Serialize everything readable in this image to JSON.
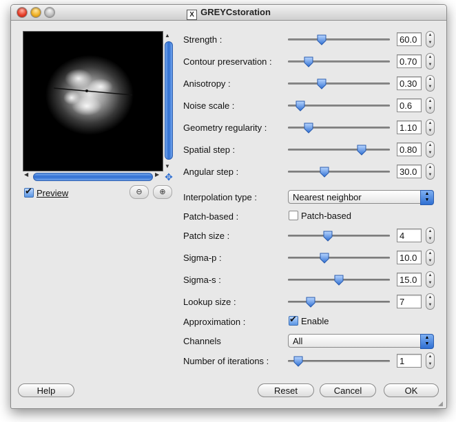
{
  "window": {
    "title": "GREYCstoration"
  },
  "preview": {
    "checkbox_label": "Preview",
    "checked": true
  },
  "params": {
    "strength": {
      "label": "Strength :",
      "value": "60.0",
      "slider_fraction": 0.33
    },
    "contour": {
      "label": "Contour preservation :",
      "value": "0.70",
      "slider_fraction": 0.2
    },
    "anisotropy": {
      "label": "Anisotropy :",
      "value": "0.30",
      "slider_fraction": 0.33
    },
    "noise_scale": {
      "label": "Noise scale :",
      "value": "0.6",
      "slider_fraction": 0.12
    },
    "geometry": {
      "label": "Geometry regularity :",
      "value": "1.10",
      "slider_fraction": 0.2
    },
    "spatial_step": {
      "label": "Spatial step :",
      "value": "0.80",
      "slider_fraction": 0.72
    },
    "angular_step": {
      "label": "Angular step :",
      "value": "30.0",
      "slider_fraction": 0.36
    },
    "interpolation": {
      "label": "Interpolation type :",
      "value": "Nearest neighbor"
    },
    "patch_based": {
      "label": "Patch-based :",
      "checkbox_label": "Patch-based",
      "checked": false
    },
    "patch_size": {
      "label": "Patch size :",
      "value": "4",
      "slider_fraction": 0.39
    },
    "sigma_p": {
      "label": "Sigma-p :",
      "value": "10.0",
      "slider_fraction": 0.36
    },
    "sigma_s": {
      "label": "Sigma-s :",
      "value": "15.0",
      "slider_fraction": 0.5
    },
    "lookup_size": {
      "label": "Lookup size :",
      "value": "7",
      "slider_fraction": 0.22
    },
    "approximation": {
      "label": "Approximation :",
      "checkbox_label": "Enable",
      "checked": true
    },
    "channels": {
      "label": "Channels",
      "value": "All"
    },
    "iterations": {
      "label": "Number of iterations :",
      "value": "1",
      "slider_fraction": 0.1
    }
  },
  "buttons": {
    "help": "Help",
    "reset": "Reset",
    "cancel": "Cancel",
    "ok": "OK"
  },
  "colors": {
    "accent": "#2f6fd2",
    "window_bg": "#e8e8e8"
  }
}
